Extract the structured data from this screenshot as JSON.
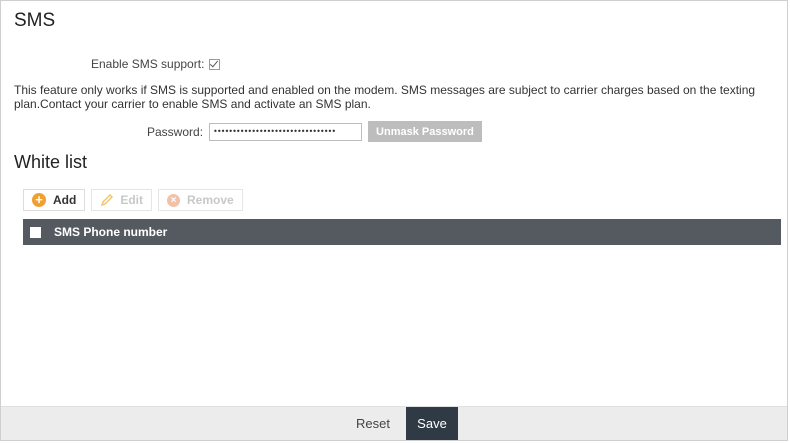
{
  "header": {
    "title": "SMS"
  },
  "sms": {
    "enable_label": "Enable SMS support:",
    "enabled": true,
    "info_text": "This feature only works if SMS is supported and enabled on the modem. SMS messages are subject to carrier charges based on the texting plan.Contact your carrier to enable SMS and activate an SMS plan.",
    "password_label": "Password:",
    "password_value": "••••••••••••••••••••••••••••••••",
    "unmask_label": "Unmask Password"
  },
  "whitelist": {
    "title": "White list",
    "toolbar": {
      "add_label": "Add",
      "edit_label": "Edit",
      "remove_label": "Remove"
    },
    "table": {
      "column_header": "SMS Phone number",
      "rows": []
    }
  },
  "footer": {
    "reset_label": "Reset",
    "save_label": "Save"
  },
  "colors": {
    "header_bar": "#555a60",
    "save_button": "#2f3a45",
    "add_icon": "#f0a030",
    "remove_icon": "#f3c0a8"
  },
  "icons": {
    "add": "plus-circle-icon",
    "edit": "pencil-icon",
    "remove": "x-circle-icon",
    "enable_check": "checkbox-checked-icon"
  }
}
